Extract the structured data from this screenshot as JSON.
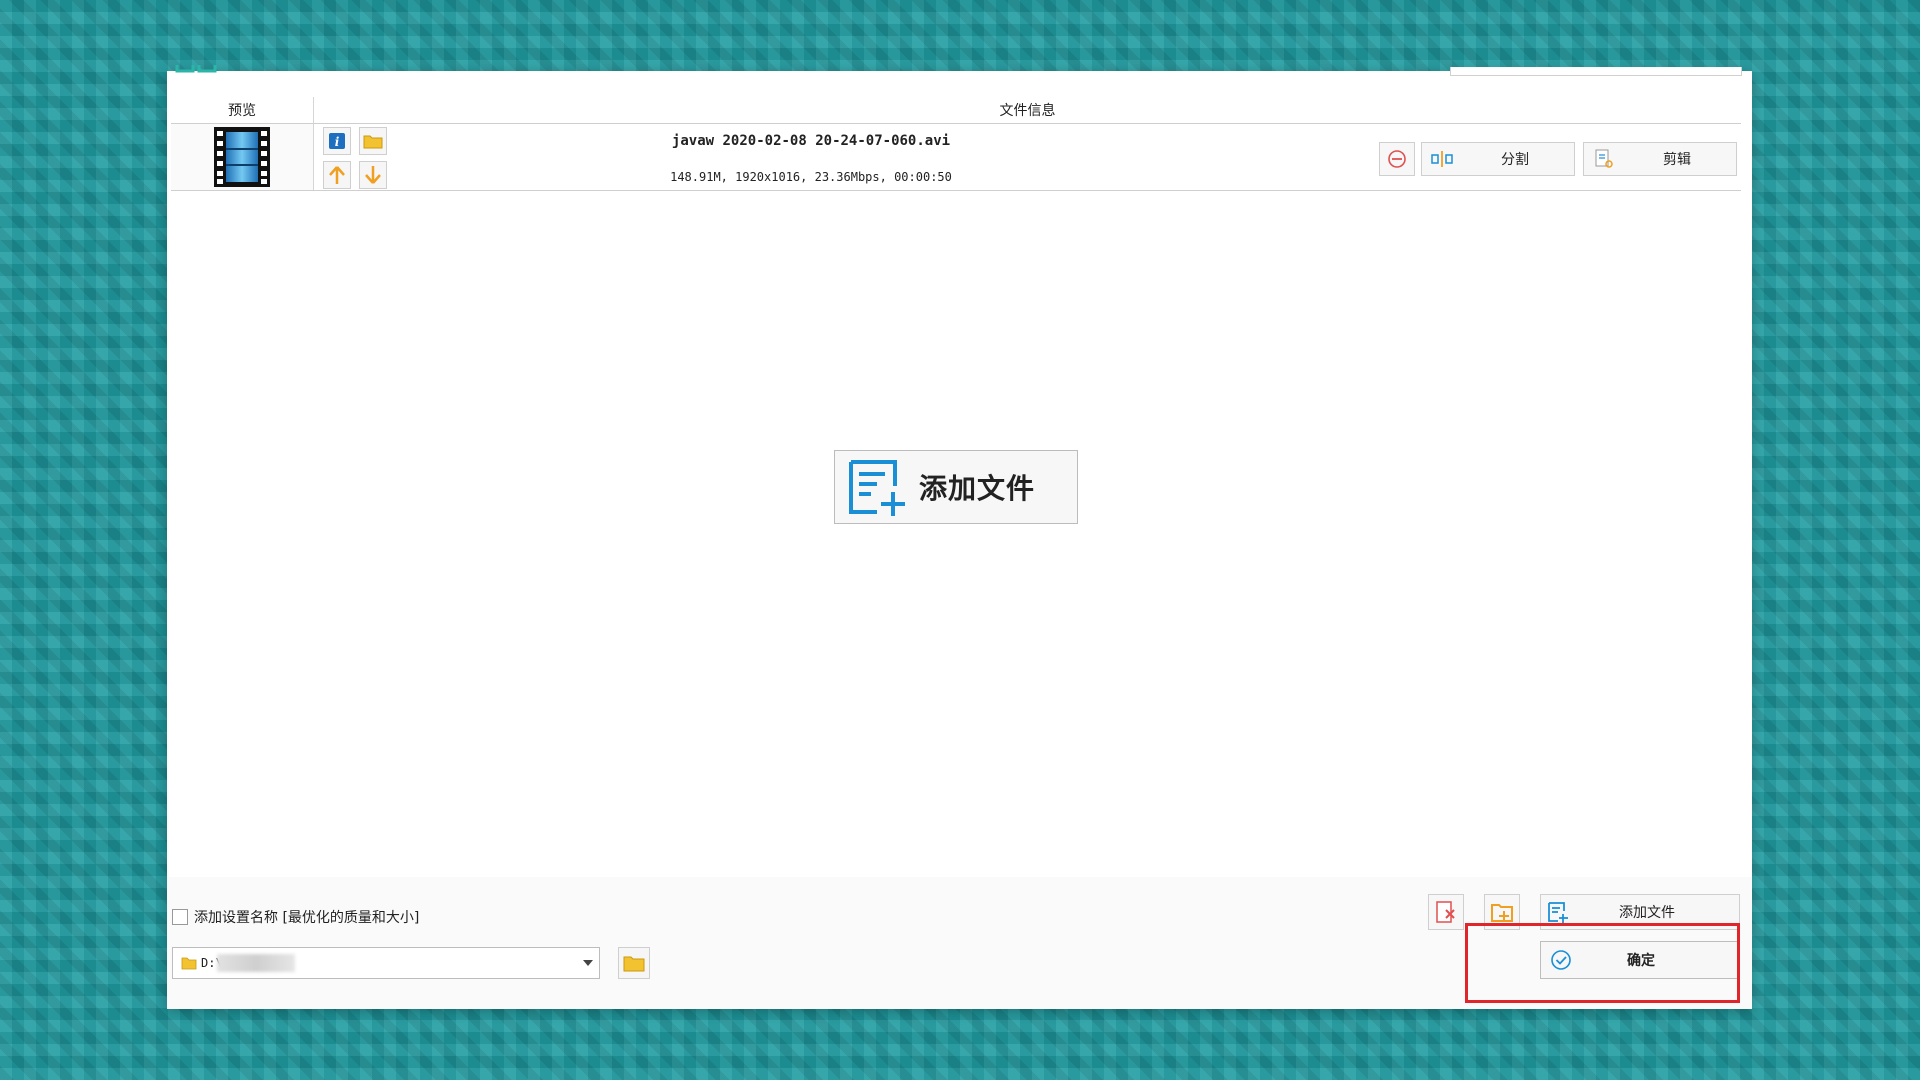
{
  "header": {
    "preview_label": "预览",
    "file_info_label": "文件信息"
  },
  "file": {
    "name": "javaw 2020-02-08 20-24-07-060.avi",
    "details": "148.91M, 1920x1016, 23.36Mbps, 00:00:50"
  },
  "row_buttons": {
    "split_label": "分割",
    "cut_label": "剪辑"
  },
  "center_add": {
    "label": "添加文件"
  },
  "bottom": {
    "checkbox_label": "添加设置名称 [最优化的质量和大小]",
    "output_path": "D:\\",
    "add_file_label": "添加文件",
    "ok_label": "确定"
  },
  "colors": {
    "accent_blue": "#1a8fd6",
    "warning_orange": "#f0a020",
    "highlight_red": "#e0262b",
    "icon_red": "#e05050"
  },
  "icons": [
    "film-icon",
    "info-icon",
    "folder-icon",
    "arrow-up-icon",
    "arrow-down-icon",
    "remove-icon",
    "split-icon",
    "cut-icon",
    "add-file-icon",
    "clear-list-icon",
    "check-circle-icon"
  ]
}
